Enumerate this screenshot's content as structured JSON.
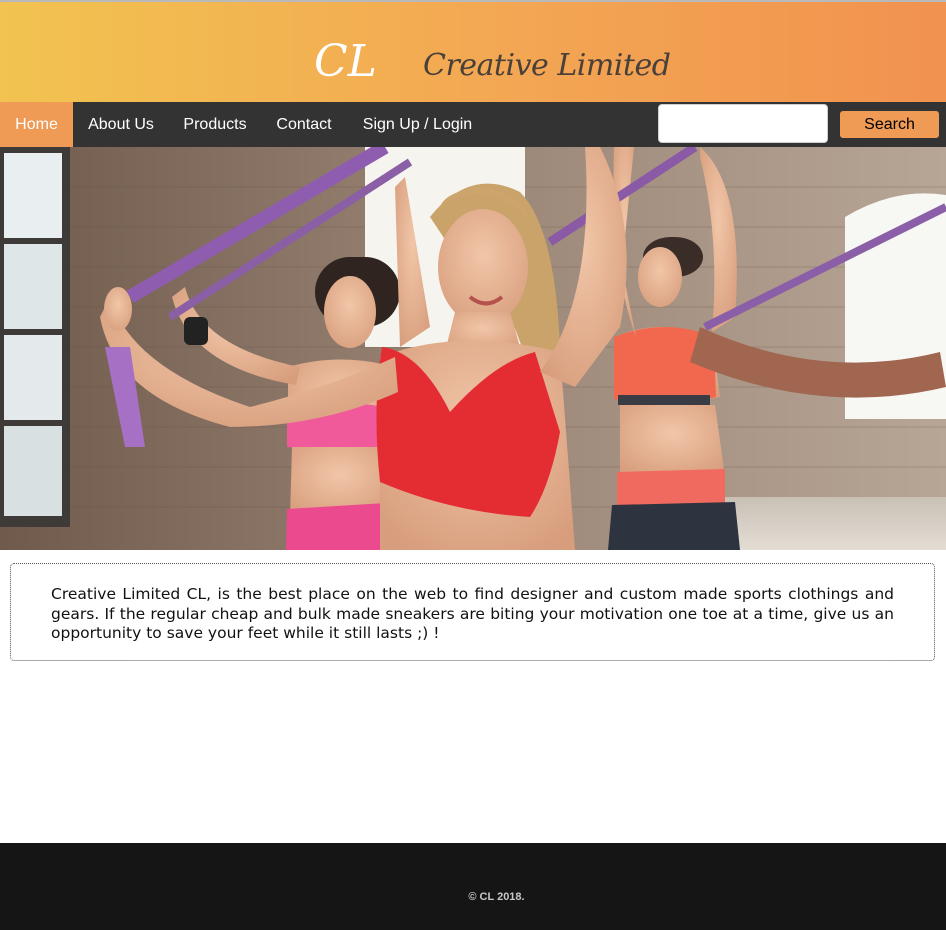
{
  "header": {
    "logo_short": "CL",
    "logo_name": "Creative Limited"
  },
  "nav": {
    "items": [
      {
        "label": "Home",
        "active": true
      },
      {
        "label": "About Us",
        "active": false
      },
      {
        "label": "Products",
        "active": false
      },
      {
        "label": "Contact",
        "active": false
      },
      {
        "label": "Sign Up / Login",
        "active": false
      }
    ]
  },
  "search": {
    "value": "",
    "button_label": "Search"
  },
  "intro": {
    "text": "Creative Limited CL, is the best place on the web to find designer and custom made sports clothings and gears. If the regular cheap and bulk made sneakers are biting your motivation one toe at a time, give us an opportunity to save your feet while it still lasts ;) !"
  },
  "footer": {
    "copyright": "© CL 2018."
  },
  "colors": {
    "accent": "#ef9a55",
    "nav_bg": "#333333",
    "header_gradient_start": "#f2c350",
    "header_gradient_end": "#f1924f",
    "footer_bg": "#151515"
  }
}
